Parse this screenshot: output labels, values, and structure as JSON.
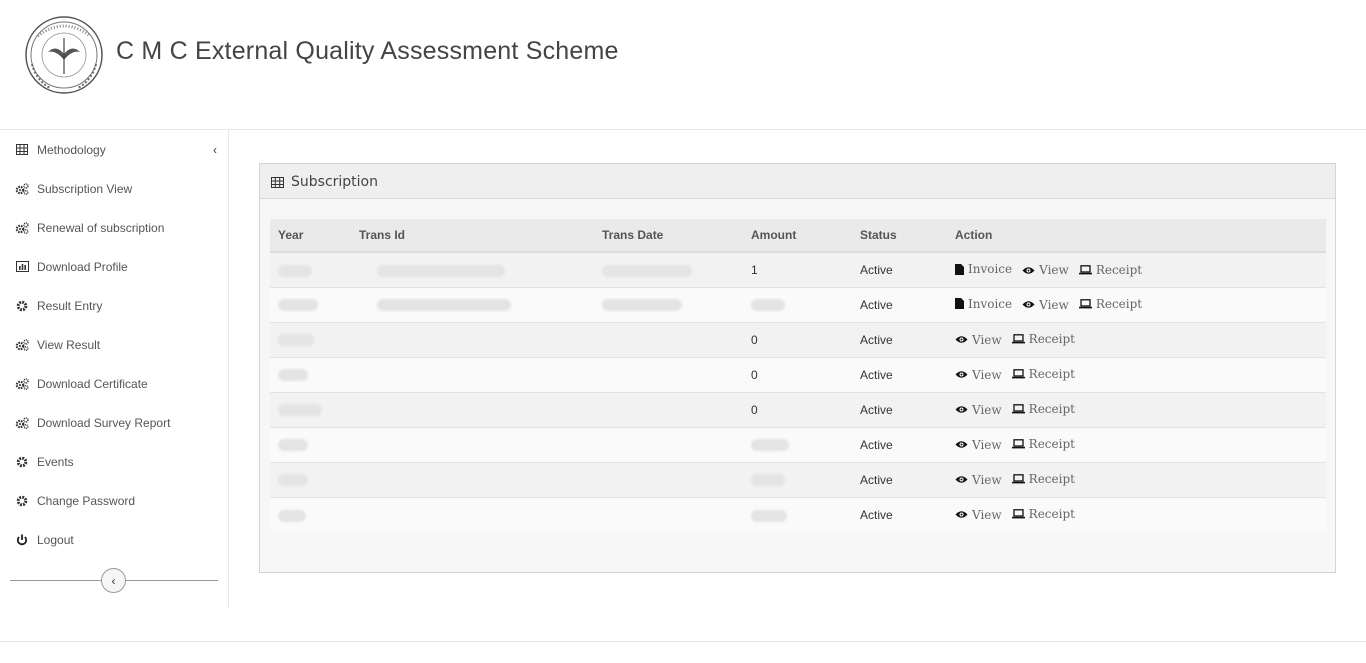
{
  "header": {
    "title": "C M C External Quality Assessment Scheme"
  },
  "sidebar": {
    "items": [
      {
        "label": "Methodology",
        "icon": "table-icon"
      },
      {
        "label": "Subscription View",
        "icon": "gears-icon"
      },
      {
        "label": "Renewal of subscription",
        "icon": "gears-icon"
      },
      {
        "label": "Download Profile",
        "icon": "bar-chart-icon"
      },
      {
        "label": "Result Entry",
        "icon": "gear-icon"
      },
      {
        "label": "View Result",
        "icon": "gears-icon"
      },
      {
        "label": "Download Certificate",
        "icon": "gears-icon"
      },
      {
        "label": "Download Survey Report",
        "icon": "gears-icon"
      },
      {
        "label": "Events",
        "icon": "gear-icon"
      },
      {
        "label": "Change Password",
        "icon": "gear-icon"
      },
      {
        "label": "Logout",
        "icon": "power-icon"
      }
    ]
  },
  "panel": {
    "title": "Subscription",
    "columns": {
      "year": "Year",
      "trans_id": "Trans Id",
      "trans_date": "Trans Date",
      "amount": "Amount",
      "status": "Status",
      "action": "Action"
    },
    "rows": [
      {
        "amount": "1",
        "status": "Active",
        "actions": [
          "Invoice",
          "View",
          "Receipt"
        ]
      },
      {
        "amount": "",
        "status": "Active",
        "actions": [
          "Invoice",
          "View",
          "Receipt"
        ]
      },
      {
        "amount": "0",
        "status": "Active",
        "actions": [
          "View",
          "Receipt"
        ]
      },
      {
        "amount": "0",
        "status": "Active",
        "actions": [
          "View",
          "Receipt"
        ]
      },
      {
        "amount": "0",
        "status": "Active",
        "actions": [
          "View",
          "Receipt"
        ]
      },
      {
        "amount": "",
        "status": "Active",
        "actions": [
          "View",
          "Receipt"
        ]
      },
      {
        "amount": "",
        "status": "Active",
        "actions": [
          "View",
          "Receipt"
        ]
      },
      {
        "amount": "",
        "status": "Active",
        "actions": [
          "View",
          "Receipt"
        ]
      }
    ]
  }
}
